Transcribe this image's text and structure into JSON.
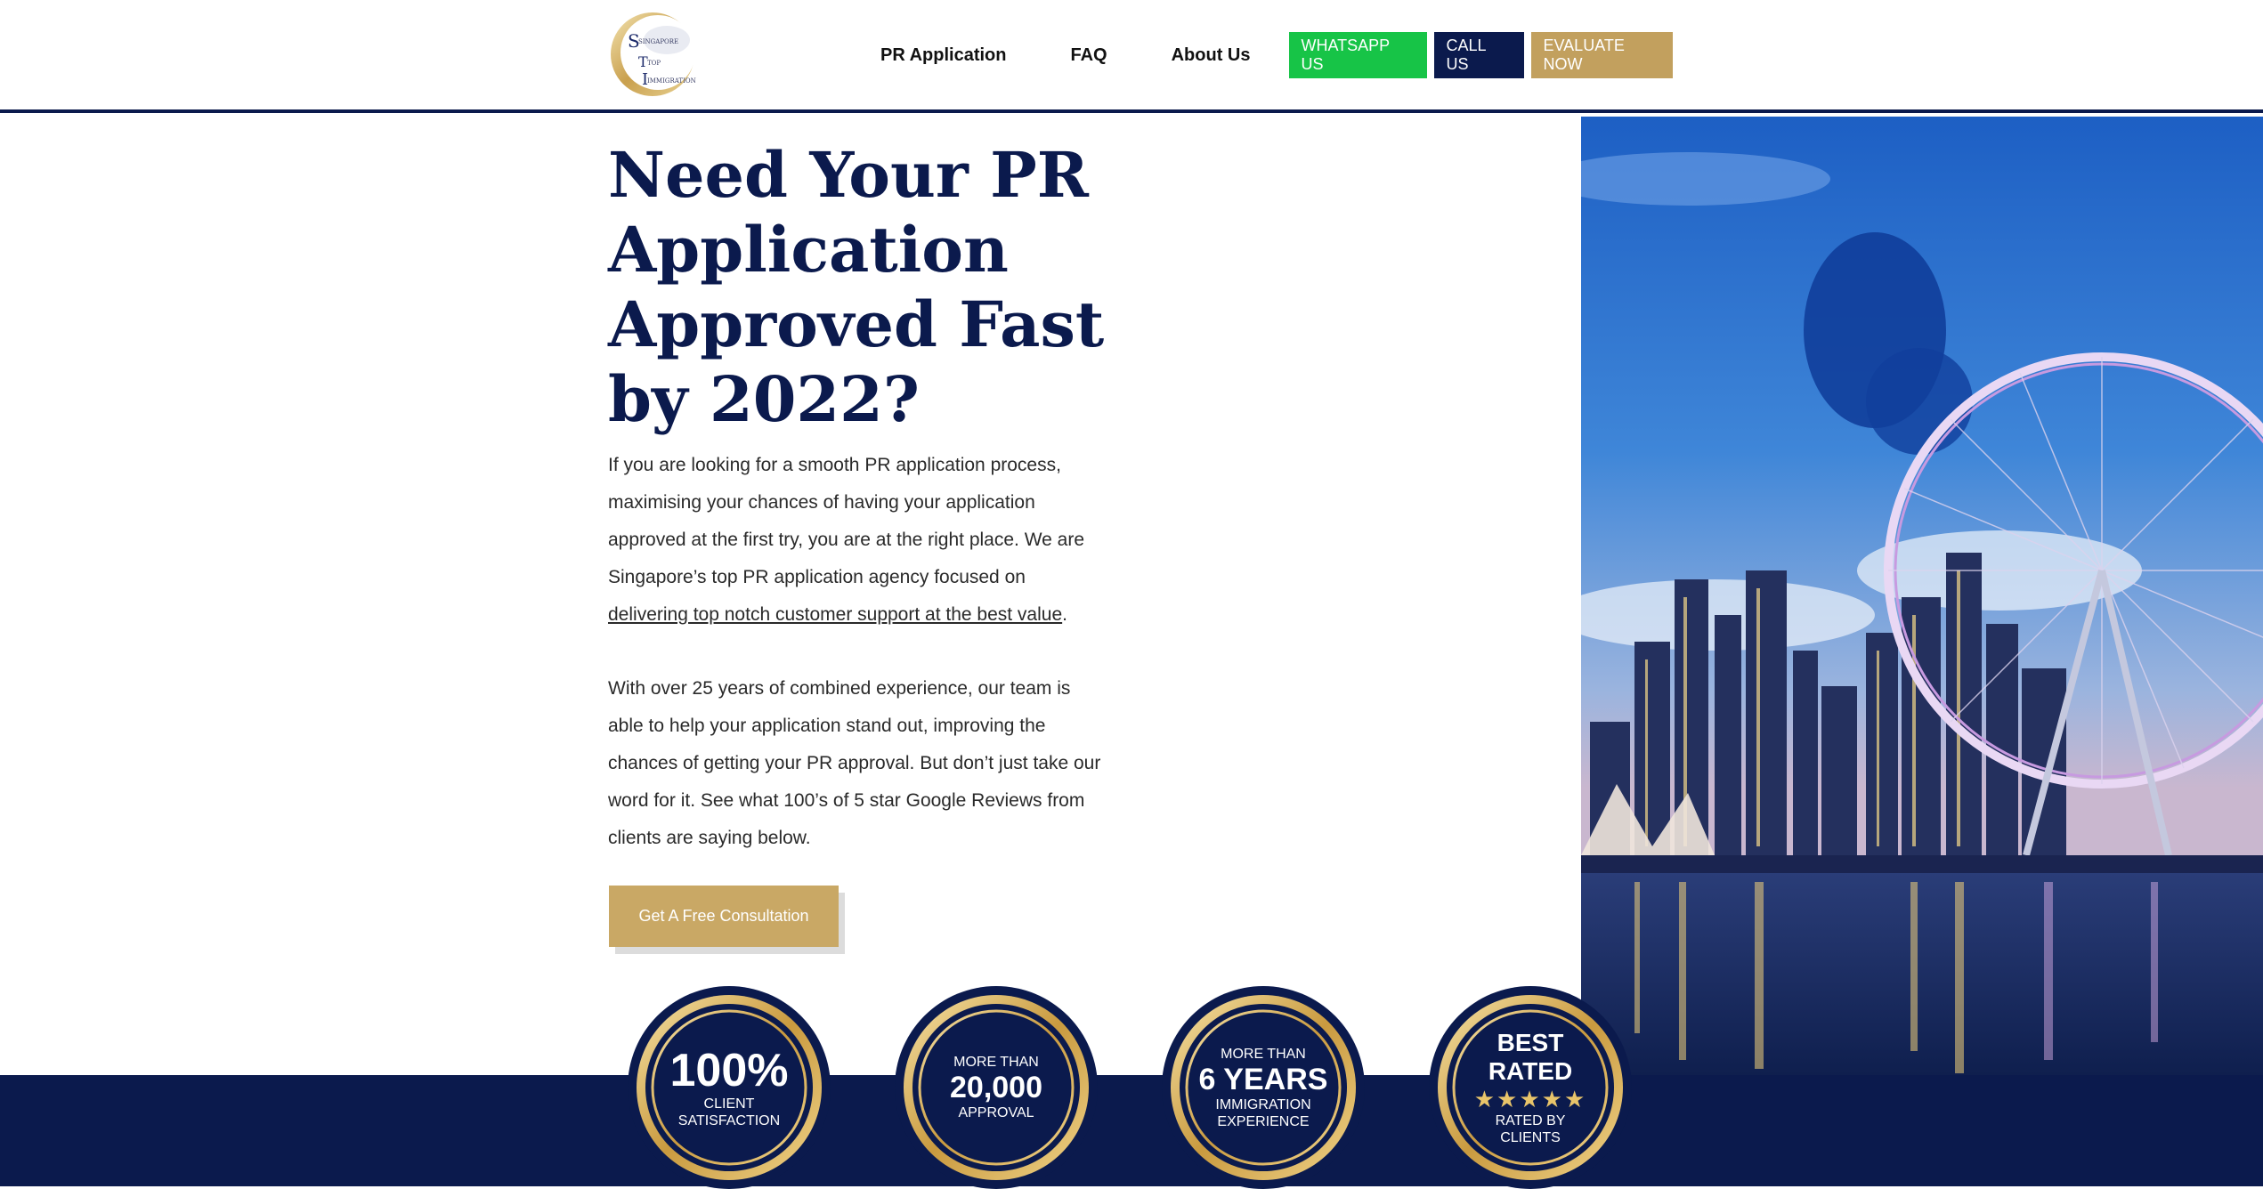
{
  "header": {
    "logo_text": [
      "SINGAPORE",
      "TOP",
      "IMMIGRATION"
    ],
    "nav": [
      {
        "label": "PR Application"
      },
      {
        "label": "FAQ"
      },
      {
        "label": "About Us"
      }
    ],
    "buttons": {
      "whatsapp": "WHATSAPP US",
      "call": "CALL US",
      "evaluate": "EVALUATE NOW"
    }
  },
  "hero": {
    "headline": "Need Your PR Application Approved Fast by 2022?",
    "para1_start": "If you are looking for a smooth PR application process, maximising your chances of having your application approved at the first try, you are at the right place. We are Singapore’s top PR application agency focused on ",
    "para1_link": "delivering top notch customer support at the best value",
    "para1_end": ".",
    "para2": "With over 25 years of combined experience, our team is able to help your application stand out, improving the chances of getting your PR approval. But don’t just take our word for it. See what 100’s of 5 star Google Reviews from clients are saying below.",
    "cta": "Get A Free Consultation"
  },
  "badges": [
    {
      "big": "100%",
      "line1": "CLIENT",
      "line2": "SATISFACTION"
    },
    {
      "top": "MORE THAN",
      "big": "20,000",
      "line1": "APPROVAL"
    },
    {
      "top": "MORE THAN",
      "big": "6 YEARS",
      "line1": "IMMIGRATION",
      "line2": "EXPERIENCE"
    },
    {
      "big1": "BEST",
      "big2": "RATED",
      "stars": "★★★★★",
      "line1": "RATED BY",
      "line2": "CLIENTS"
    }
  ],
  "colors": {
    "navy": "#0b1a4d",
    "gold": "#c2a05e",
    "green": "#17c447"
  }
}
